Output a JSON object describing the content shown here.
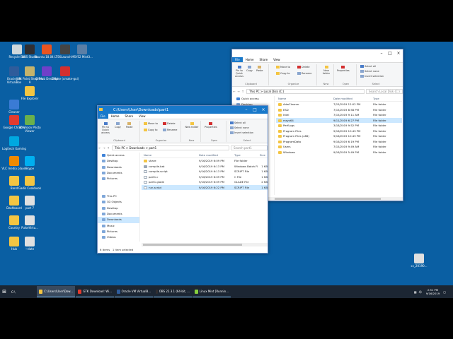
{
  "desktop_icons": [
    {
      "label": "Recycle Bin",
      "color": "#cfd8dc"
    },
    {
      "label": "OBS Studio",
      "color": "#302e31"
    },
    {
      "label": "Ubuntu 18.04 LTS",
      "color": "#e95420"
    },
    {
      "label": "XLaunch",
      "color": "#444444"
    },
    {
      "label": "MSYS2 Mint3...",
      "color": "#5b7fa6"
    },
    {
      "label": "Oracle VM VirtualBox",
      "color": "#2f5c9b"
    },
    {
      "label": "Jasc Paint Shop Pro 9",
      "color": "#c4b36b"
    },
    {
      "label": "GitHub Desktop",
      "color": "#6e40c9"
    },
    {
      "label": "CMake (cmake-gui)",
      "color": "#d32f2f"
    },
    {
      "label": "File Explorer",
      "color": "#f4c542"
    },
    {
      "label": "Cleaner",
      "color": "#3a7bd5"
    },
    {
      "label": "Google Chrome",
      "color": "#e33b2e"
    },
    {
      "label": "3D Vision Photo Viewer",
      "color": "#6ab04c"
    },
    {
      "label": "Logitech Gaming",
      "color": "#00a8e0"
    },
    {
      "label": "VLC media player",
      "color": "#f08a00"
    },
    {
      "label": "Skype",
      "color": "#00aff0"
    },
    {
      "label": "Band",
      "color": "#f4c542"
    },
    {
      "label": "Gadis Cookbook",
      "color": "#f4c542"
    },
    {
      "label": "Dashboard",
      "color": "#f4c542"
    },
    {
      "label": "part 7",
      "color": "#e0e0e0"
    },
    {
      "label": "Country",
      "color": "#f4c542"
    },
    {
      "label": "PulseVirtu...",
      "color": "#e0e0e0"
    },
    {
      "label": "Hub",
      "color": "#f4c542"
    },
    {
      "label": "~date",
      "color": "#e0e0e0"
    },
    {
      "label": "cc_20190...",
      "color": "#e0e0e0"
    }
  ],
  "win_back": {
    "title": "",
    "tabs": [
      "File",
      "Home",
      "Share",
      "View"
    ],
    "groups": [
      "Clipboard",
      "Organize",
      "New",
      "Open",
      "Select"
    ],
    "buttons": {
      "pin": "Pin to Quick access",
      "copy": "Copy",
      "paste": "Paste",
      "move_to": "Move to",
      "copy_to": "Copy to",
      "delete": "Delete",
      "rename": "Rename",
      "new_folder": "New folder",
      "properties": "Properties",
      "select_all": "Select all",
      "select_none": "Select none",
      "invert_selection": "Invert selection"
    },
    "path": "This PC > Local Disk (C:)",
    "search_placeholder": "Search Local Disk (C:)",
    "nav": [
      "Quick access",
      "Desktop",
      "Downloads"
    ],
    "columns": [
      "Name",
      "Date modified",
      "Type"
    ],
    "files": [
      {
        "name": "AdwCleaner",
        "date": "7/15/2019 12:02 PM",
        "type": "File folder"
      },
      {
        "name": "ESD",
        "date": "7/15/2019 8:58 PM",
        "type": "File folder"
      },
      {
        "name": "Intel",
        "date": "7/15/2019 9:11 AM",
        "type": "File folder"
      },
      {
        "name": "msys64",
        "date": "9/11/2019 6:27 PM",
        "type": "File folder"
      },
      {
        "name": "PerfLogs",
        "date": "3/18/2019 9:52 PM",
        "type": "File folder"
      },
      {
        "name": "Program Files",
        "date": "9/16/2019 10:49 PM",
        "type": "File folder"
      },
      {
        "name": "Program Files (x86)",
        "date": "9/16/2019 10:49 PM",
        "type": "File folder"
      },
      {
        "name": "ProgramData",
        "date": "9/16/2019 6:19 PM",
        "type": "File folder"
      },
      {
        "name": "Users",
        "date": "7/15/2019 9:49 AM",
        "type": "File folder"
      },
      {
        "name": "Windows",
        "date": "9/16/2019 5:49 PM",
        "type": "File folder"
      }
    ],
    "selected_index": 3
  },
  "win_front": {
    "title": "C:\\Users\\User\\Downloads\\part1",
    "tabs": [
      "File",
      "Home",
      "Share",
      "View"
    ],
    "groups": [
      "Clipboard",
      "Organize",
      "New",
      "Open",
      "Select"
    ],
    "buttons": {
      "pin": "Pin to Quick access",
      "copy": "Copy",
      "paste": "Paste",
      "move_to": "Move to",
      "copy_to": "Copy to",
      "delete": "Delete",
      "rename": "Rename",
      "new_folder": "New folder",
      "properties": "Properties",
      "select_all": "Select all",
      "select_none": "Select none",
      "invert_selection": "Invert selection"
    },
    "path": "This PC > Downloads > part1",
    "search_placeholder": "Search part1",
    "nav": [
      "Quick access",
      "Desktop",
      "Downloads",
      "Documents",
      "Pictures",
      "",
      "",
      "This PC",
      "3D Objects",
      "Desktop",
      "Documents",
      "Downloads",
      "Music",
      "Pictures",
      "Videos",
      "Local Disk (C:)",
      "",
      "Network"
    ],
    "nav_selected": 11,
    "columns": [
      "Name",
      "Date modified",
      "Type",
      "Size"
    ],
    "files": [
      {
        "name": "share",
        "date": "9/16/2019 6:09 PM",
        "type": "File folder",
        "size": "",
        "kind": "folder"
      },
      {
        "name": "compile.bat",
        "date": "9/16/2019 6:13 PM",
        "type": "Windows Batch File",
        "size": "1 KB",
        "kind": "bat"
      },
      {
        "name": "compile.script",
        "date": "9/16/2019 6:13 PM",
        "type": "SCRIPT File",
        "size": "1 KB",
        "kind": "file"
      },
      {
        "name": "part1.c",
        "date": "9/16/2019 6:09 PM",
        "type": "C File",
        "size": "1 KB",
        "kind": "file"
      },
      {
        "name": "part1.glade",
        "date": "9/16/2019 6:09 PM",
        "type": "GLADE File",
        "size": "2 KB",
        "kind": "file"
      },
      {
        "name": "run.script",
        "date": "9/16/2019 6:22 PM",
        "type": "SCRIPT File",
        "size": "1 KB",
        "kind": "file"
      }
    ],
    "selected_index": 5,
    "status_items": "6 items",
    "status_selected": "1 item selected"
  },
  "taskbar": {
    "search_label": "C:\\",
    "apps": [
      {
        "label": "C:\\Users\\User\\Dow...",
        "color": "#f4c542",
        "active": true
      },
      {
        "label": "GTK Download: Wi...",
        "color": "#e33b2e",
        "active": false
      },
      {
        "label": "Oracle VM VirtualB...",
        "color": "#2f5c9b",
        "active": false
      },
      {
        "label": "OBS 22.3.1 (64-bit, ...",
        "color": "#302e31",
        "active": false
      },
      {
        "label": "Linux Mint [Runnin...",
        "color": "#87cf3e",
        "active": false
      }
    ],
    "time": "2:51 PM",
    "date": "9/16/2019",
    "tray_text": "4)"
  },
  "colors": {
    "desktop": "#0a5fa3",
    "folder": "#f4c542",
    "accent": "#1979ca",
    "selection": "#cce8ff"
  }
}
